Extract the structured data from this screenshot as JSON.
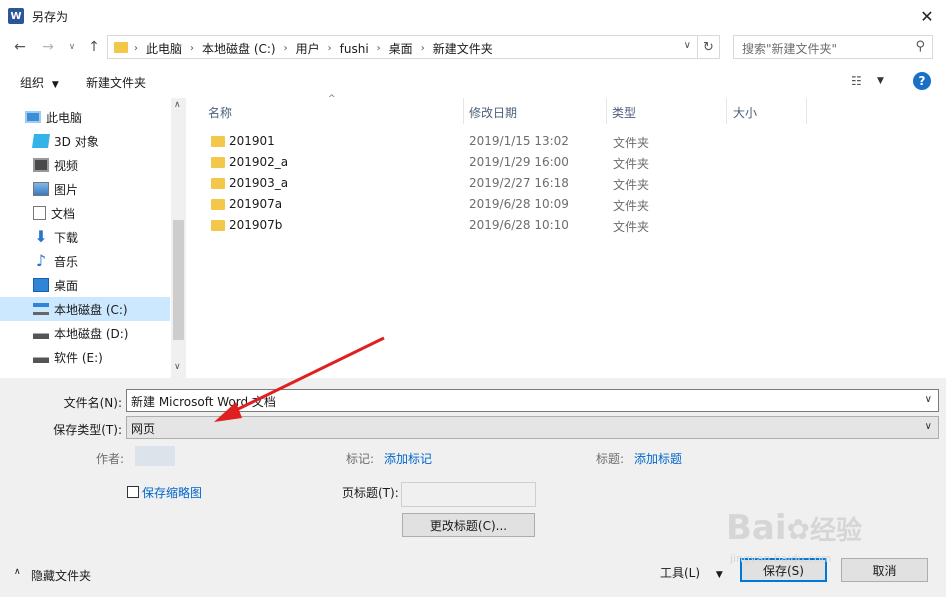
{
  "window": {
    "title": "另存为",
    "app_icon": "W"
  },
  "nav": {
    "crumbs": [
      "此电脑",
      "本地磁盘 (C:)",
      "用户",
      "fushi",
      "桌面",
      "新建文件夹"
    ],
    "search_placeholder": "搜索\"新建文件夹\""
  },
  "toolbar": {
    "organize": "组织",
    "new_folder": "新建文件夹"
  },
  "sidebar": {
    "items": [
      {
        "label": "此电脑",
        "icon": "computer-icon"
      },
      {
        "label": "3D 对象",
        "icon": "3d-objects-icon"
      },
      {
        "label": "视频",
        "icon": "video-icon"
      },
      {
        "label": "图片",
        "icon": "pictures-icon"
      },
      {
        "label": "文档",
        "icon": "documents-icon"
      },
      {
        "label": "下载",
        "icon": "download-icon"
      },
      {
        "label": "音乐",
        "icon": "music-icon"
      },
      {
        "label": "桌面",
        "icon": "desktop-icon"
      },
      {
        "label": "本地磁盘 (C:)",
        "icon": "drive-c-icon"
      },
      {
        "label": "本地磁盘 (D:)",
        "icon": "drive-icon"
      },
      {
        "label": "软件 (E:)",
        "icon": "drive-icon"
      }
    ],
    "selected": "本地磁盘 (C:)"
  },
  "files": {
    "columns": [
      "名称",
      "修改日期",
      "类型",
      "大小"
    ],
    "rows": [
      {
        "name": "201901",
        "date": "2019/1/15 13:02",
        "type": "文件夹",
        "size": ""
      },
      {
        "name": "201902_a",
        "date": "2019/1/29 16:00",
        "type": "文件夹",
        "size": ""
      },
      {
        "name": "201903_a",
        "date": "2019/2/27 16:18",
        "type": "文件夹",
        "size": ""
      },
      {
        "name": "201907a",
        "date": "2019/6/28 10:09",
        "type": "文件夹",
        "size": ""
      },
      {
        "name": "201907b",
        "date": "2019/6/28 10:10",
        "type": "文件夹",
        "size": ""
      }
    ]
  },
  "form": {
    "filename_label": "文件名(N):",
    "filename_value": "新建 Microsoft Word 文档",
    "filetype_label": "保存类型(T):",
    "filetype_value": "网页",
    "author_label": "作者:",
    "tags_label": "标记:",
    "tags_link": "添加标记",
    "title_label": "标题:",
    "title_link": "添加标题",
    "save_thumb_label": "保存缩略图",
    "page_title_label": "页标题(T):",
    "change_title_button": "更改标题(C)..."
  },
  "footer": {
    "hide_folders": "隐藏文件夹",
    "tools": "工具(L)",
    "save": "保存(S)",
    "cancel": "取消"
  },
  "watermark": {
    "text": "Bai",
    "text2": "经验",
    "sub": "jingyan.baidu.com"
  },
  "colors": {
    "accent": "#0078d7",
    "selected": "#cce8ff",
    "folder": "#f3c84a",
    "annotation_arrow": "#e02020"
  }
}
